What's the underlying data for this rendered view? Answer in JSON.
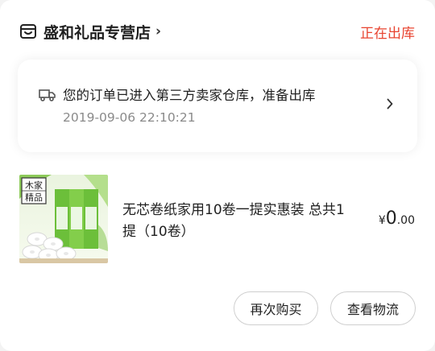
{
  "store": {
    "name": "盛和礼品专营店",
    "chevron": "›",
    "status": "正在出库"
  },
  "logistics": {
    "message": "您的订单已进入第三方卖家仓库，准备出库",
    "time": "2019-09-06 22:10:21"
  },
  "product": {
    "title": "无芯卷纸家用10卷一提实惠装 总共1提（10卷）",
    "image_brand_lines": [
      "木家",
      "精品"
    ],
    "price": {
      "currency": "¥",
      "integer": "0",
      "decimal": ".00"
    }
  },
  "actions": {
    "rebuy_label": "再次购买",
    "view_logistics_label": "查看物流"
  },
  "colors": {
    "accent": "#e8432f",
    "package_green": "#7cc242"
  }
}
